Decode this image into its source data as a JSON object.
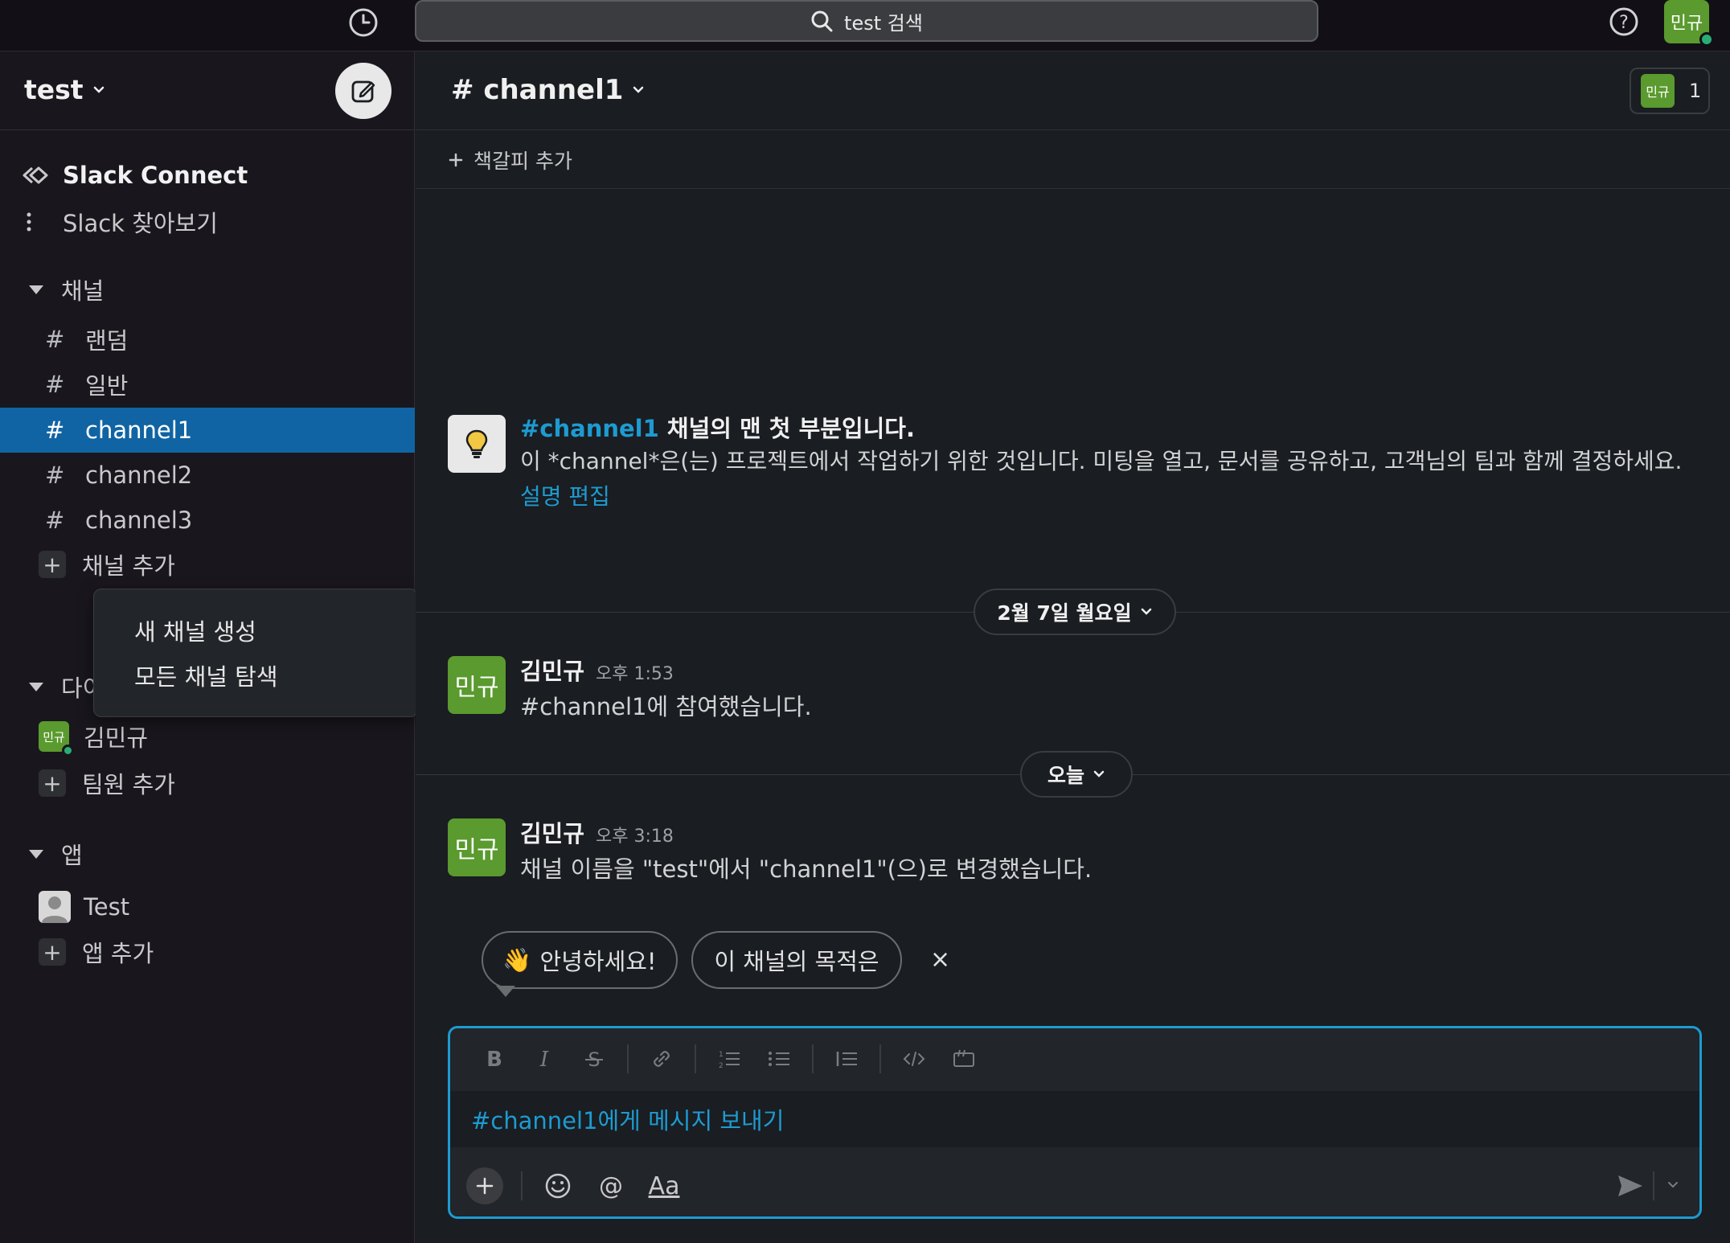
{
  "topbar": {
    "search_text": "test 검색",
    "user_initials": "민규"
  },
  "workspace": {
    "name": "test",
    "compose_icon": "compose-icon"
  },
  "sidebar": {
    "top_items": [
      {
        "label": "Slack Connect",
        "icon": "slack-connect-icon"
      },
      {
        "label": "Slack 찾아보기",
        "icon": "more-vertical-icon"
      }
    ],
    "channels_section": "채널",
    "channels": [
      "랜덤",
      "일반",
      "channel1",
      "channel2",
      "channel3"
    ],
    "active_channel": "channel1",
    "add_channel": "채널 추가",
    "dm_section": "다이렉트 메시지",
    "dm_user_initials": "민규",
    "dm_user_name": "김민규",
    "add_member": "팀원 추가",
    "apps_section": "앱",
    "apps": [
      "Test"
    ],
    "add_app": "앱 추가"
  },
  "dropdown": {
    "items": [
      "새 채널 생성",
      "모든 채널 탐색"
    ]
  },
  "channel": {
    "title": "# channel1",
    "member_initials": "민규",
    "member_count": "1",
    "bookmark_add": "책갈피 추가"
  },
  "intro": {
    "channel_link": "#channel1",
    "title_rest": " 채널의 맨 첫 부분입니다.",
    "description": "이 *channel*은(는) 프로젝트에서 작업하기 위한 것입니다. 미팅을 열고, 문서를 공유하고, 고객님의 팀과 함께 결정하세요. ",
    "edit_link": "설명 편집"
  },
  "messages": [
    {
      "date_pill": "2월 7일 월요일",
      "author": "김민규",
      "initials": "민규",
      "time": "오후 1:53",
      "text": "#channel1에 참여했습니다."
    },
    {
      "date_pill": "오늘",
      "author": "김민규",
      "initials": "민규",
      "time": "오후 3:18",
      "text": "채널 이름을 \"test\"에서 \"channel1\"(으)로 변경했습니다."
    }
  ],
  "suggestions": {
    "chips": [
      {
        "emoji": "👋",
        "label": "안녕하세요!"
      },
      {
        "emoji": "",
        "label": "이 채널의 목적은"
      }
    ],
    "close": "×"
  },
  "composer": {
    "placeholder": "#channel1에게 메시지 보내기",
    "format_buttons": [
      "bold-icon",
      "italic-icon",
      "strikethrough-icon",
      "link-icon",
      "ordered-list-icon",
      "bullet-list-icon",
      "blockquote-icon",
      "code-icon",
      "code-block-icon"
    ],
    "aa_label": "Aa"
  },
  "colors": {
    "accent": "#1164a3",
    "link": "#1d9bd1",
    "avatar": "#5a9a2e",
    "presence": "#2bac76"
  }
}
